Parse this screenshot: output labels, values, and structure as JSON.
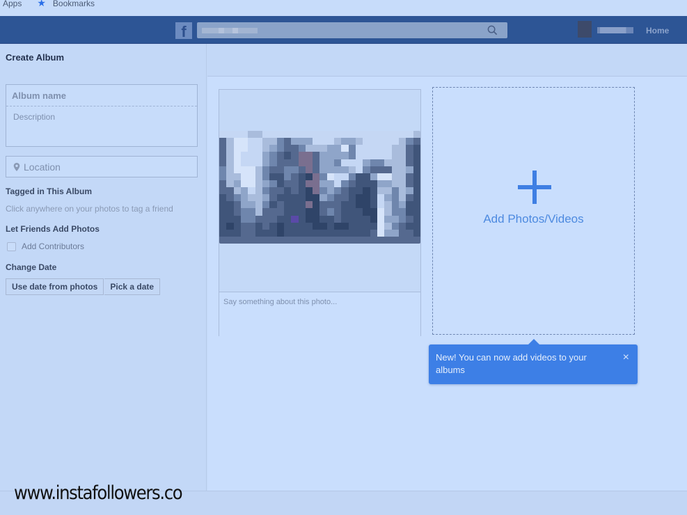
{
  "browser": {
    "bookmarks_bar": [
      {
        "label": "Apps",
        "icon": "apps-icon"
      },
      {
        "label": "Bookmarks",
        "icon": "star-icon"
      }
    ]
  },
  "header": {
    "logo": "f",
    "search_placeholder": "",
    "nav": [
      {
        "label": "Home"
      }
    ]
  },
  "page": {
    "title": "Create Album"
  },
  "sidebar": {
    "album_name_placeholder": "Album name",
    "description_placeholder": "Description",
    "location_placeholder": "Location",
    "tagged_label": "Tagged in This Album",
    "tagged_hint": "Click anywhere on your photos to tag a friend",
    "friends_label": "Let Friends Add Photos",
    "add_contributors_label": "Add Contributors",
    "add_contributors_checked": false,
    "change_date_label": "Change Date",
    "date_buttons": [
      "Use date from photos",
      "Pick a date"
    ]
  },
  "main": {
    "photo": {
      "caption_placeholder": "Say something about this photo..."
    },
    "add_media_label": "Add Photos/Videos",
    "tooltip": {
      "text": "New! You can now add videos to your albums",
      "close": "×"
    }
  },
  "watermark": "www.instafollowers.co",
  "colors": {
    "header_bg": "#2d5595",
    "accent": "#3d7fe6",
    "page_bg": "#c3d8f7"
  },
  "photo_palette": [
    "#c5d7f4",
    "#a9bcdc",
    "#8fa5c9",
    "#6f86ad",
    "#55698f",
    "#40557a",
    "#2f4468",
    "#7a6f8f",
    "#5a4aa8",
    "#d6e4fa",
    "#93a8c2"
  ],
  "photo_pixels": [
    "0000110000000000000000000001",
    "4199001134222000122100000134",
    "4199001234431112293000001145",
    "4190002345477422223000001145",
    "4190002344477422300023311145",
    "3199913443347422221034441125",
    "3119913553456739003552991145",
    "4129912354457722034555221145",
    "4412013445456732345565113125",
    "5432112455556623445665023145",
    "5542213545557644455665013255",
    "5543314445556643455566913355",
    "5553344455856655455556922345",
    "5654454565555665665555913455",
    "5554455565555555555554922445",
    "4444444444444444444444444444"
  ]
}
